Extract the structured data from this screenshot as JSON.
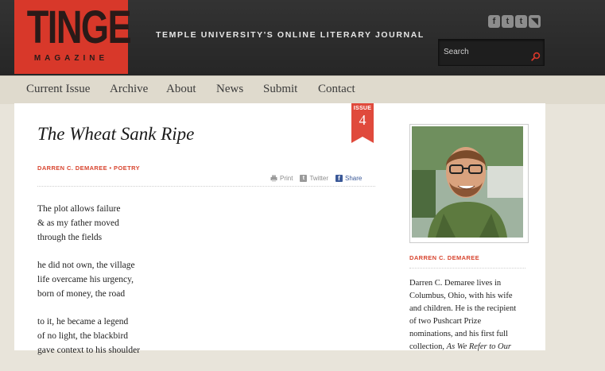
{
  "header": {
    "logo_main": "TINGE",
    "logo_sub": "MAGAZINE",
    "tagline": "TEMPLE UNIVERSITY'S ONLINE LITERARY JOURNAL",
    "social": [
      {
        "icon": "facebook-icon",
        "glyph": "f"
      },
      {
        "icon": "tumblr-icon",
        "glyph": "t"
      },
      {
        "icon": "twitter-icon",
        "glyph": "t"
      },
      {
        "icon": "rss-icon",
        "glyph": "◥"
      }
    ],
    "search_placeholder": "Search"
  },
  "nav": {
    "items": [
      "Current Issue",
      "Archive",
      "About",
      "News",
      "Submit",
      "Contact"
    ]
  },
  "article": {
    "issue_label": "ISSUE",
    "issue_number": "4",
    "title": "The Wheat Sank Ripe",
    "byline": "DARREN C. DEMAREE • POETRY",
    "share": {
      "print": "Print",
      "twitter": "Twitter",
      "facebook": "Share"
    },
    "stanzas": [
      [
        "The plot allows failure",
        "& as my father moved",
        "through the fields"
      ],
      [
        "he did not own, the village",
        "life overcame his urgency,",
        "born of money, the road"
      ],
      [
        "to it, he became a legend",
        "of no light, the blackbird",
        "gave context to his shoulder"
      ]
    ]
  },
  "sidebar": {
    "author_name": "DARREN C. DEMAREE",
    "bio_lines": [
      "Darren C. Demaree lives in",
      "Columbus, Ohio, with his wife",
      "and children. He is the recipient",
      "of two Pushcart Prize",
      "nominations, and his first full"
    ],
    "bio_last_prefix": "collection, ",
    "bio_last_italic": "As We Refer to Our"
  },
  "colors": {
    "brand_red": "#d8382a",
    "accent_red": "#d8452f",
    "header_bg": "#2b2b2b",
    "nav_bg": "#dfdacd"
  }
}
